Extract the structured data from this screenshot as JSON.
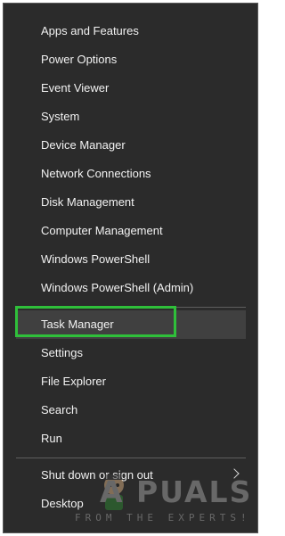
{
  "menu": {
    "items_group1": [
      {
        "label": "Apps and Features"
      },
      {
        "label": "Power Options"
      },
      {
        "label": "Event Viewer"
      },
      {
        "label": "System"
      },
      {
        "label": "Device Manager"
      },
      {
        "label": "Network Connections"
      },
      {
        "label": "Disk Management"
      },
      {
        "label": "Computer Management"
      },
      {
        "label": "Windows PowerShell"
      },
      {
        "label": "Windows PowerShell (Admin)"
      }
    ],
    "items_group2": [
      {
        "label": "Task Manager"
      },
      {
        "label": "Settings"
      },
      {
        "label": "File Explorer"
      },
      {
        "label": "Search"
      },
      {
        "label": "Run"
      }
    ],
    "items_group3": [
      {
        "label": "Shut down or sign out",
        "submenu": true,
        "icon": "chevron-right-icon"
      },
      {
        "label": "Desktop"
      }
    ]
  },
  "colors": {
    "menu_background": "#2b2b2b",
    "hover_background": "#404040",
    "highlight_border": "#2fbf3a",
    "text": "#f2f2f2"
  },
  "watermark": {
    "title": "A  PUALS",
    "subtitle": "FROM THE EXPERTS!",
    "icon": "appuals-mascot-icon"
  }
}
